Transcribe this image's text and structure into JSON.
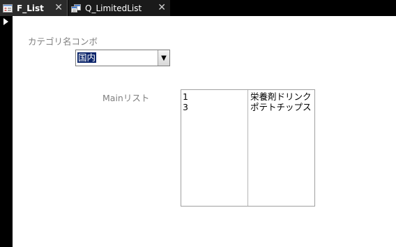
{
  "tabs": [
    {
      "label": "F_List",
      "icon": "form-icon"
    },
    {
      "label": "Q_LimitedList",
      "icon": "query-icon"
    }
  ],
  "tab_close_glyph": "✕",
  "form": {
    "category_label": "カテゴリ名コンボ",
    "category_value": "国内",
    "main_list_label": "Mainリスト",
    "main_list": {
      "rows": [
        {
          "id": "1",
          "name": "栄養剤ドリンク"
        },
        {
          "id": "3",
          "name": "ポテトチップス"
        }
      ]
    }
  },
  "colors": {
    "tab_background": "#000000",
    "selection_highlight": "#0a246a",
    "label_text": "#7f7f7f"
  }
}
